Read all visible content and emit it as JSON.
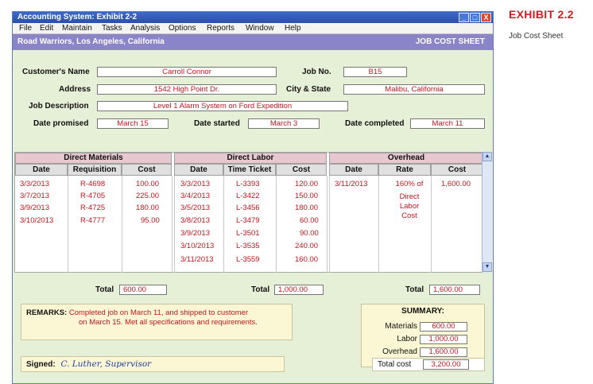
{
  "exhibit": {
    "label": "EXHIBIT 2.2",
    "subtitle": "Job Cost Sheet"
  },
  "window": {
    "title": "Accounting System: Exhibit 2-2",
    "buttons": [
      "_",
      "□",
      "X"
    ]
  },
  "menu": [
    "File",
    "Edit",
    "Maintain",
    "Tasks",
    "Analysis",
    "Options",
    "Reports",
    "Window",
    "Help"
  ],
  "banner": {
    "company": "Road Warriors, Los Angeles, California",
    "sheet_title": "JOB COST SHEET"
  },
  "header": {
    "customer_label": "Customer's Name",
    "customer": "Carroll Connor",
    "job_no_label": "Job No.",
    "job_no": "B15",
    "address_label": "Address",
    "address": "1542 High Point Dr.",
    "city_label": "City & State",
    "city": "Malibu, California",
    "description_label": "Job Description",
    "description": "Level 1 Alarm System on Ford Expedition",
    "date_promised_label": "Date promised",
    "date_promised": "March 15",
    "date_started_label": "Date started",
    "date_started": "March 3",
    "date_completed_label": "Date completed",
    "date_completed": "March 11"
  },
  "table": {
    "groups": [
      "Direct Materials",
      "Direct Labor",
      "Overhead"
    ],
    "columns": [
      "Date",
      "Requisition",
      "Cost",
      "Date",
      "Time Ticket",
      "Cost",
      "Date",
      "Rate",
      "Cost"
    ],
    "materials": [
      {
        "date": "3/3/2013",
        "req": "R-4698",
        "cost": "100.00"
      },
      {
        "date": "3/7/2013",
        "req": "R-4705",
        "cost": "225.00"
      },
      {
        "date": "3/9/2013",
        "req": "R-4725",
        "cost": "180.00"
      },
      {
        "date": "3/10/2013",
        "req": "R-4777",
        "cost": "95.00"
      }
    ],
    "labor": [
      {
        "date": "3/3/2013",
        "ticket": "L-3393",
        "cost": "120.00"
      },
      {
        "date": "3/4/2013",
        "ticket": "L-3422",
        "cost": "150.00"
      },
      {
        "date": "3/5/2013",
        "ticket": "L-3456",
        "cost": "180.00"
      },
      {
        "date": "3/8/2013",
        "ticket": "L-3479",
        "cost": "60.00"
      },
      {
        "date": "3/9/2013",
        "ticket": "L-3501",
        "cost": "90.00"
      },
      {
        "date": "3/10/2013",
        "ticket": "L-3535",
        "cost": "240.00"
      },
      {
        "date": "3/11/2013",
        "ticket": "L-3559",
        "cost": "160.00"
      }
    ],
    "overhead": {
      "date": "3/11/2013",
      "rate_line1": "160% of",
      "rate_rest": [
        "Direct",
        "Labor",
        "Cost"
      ],
      "cost": "1,600.00"
    }
  },
  "totals": {
    "label": "Total",
    "materials": "600.00",
    "labor": "1,000.00",
    "overhead": "1,600.00"
  },
  "remarks": {
    "label": "REMARKS:",
    "line1": "Completed job on March 11, and shipped to customer",
    "line2": "on March 15. Met all specifications and requirements."
  },
  "summary": {
    "title": "SUMMARY:",
    "materials_label": "Materials",
    "materials": "600.00",
    "labor_label": "Labor",
    "labor": "1,000.00",
    "overhead_label": "Overhead",
    "overhead": "1,600.00",
    "total_label": "Total cost",
    "total": "3,200.00"
  },
  "signed": {
    "label": "Signed:",
    "signature": "C. Luther, Supervisor"
  },
  "colors": {
    "entry_red": "#c4161c",
    "banner": "#8a84c8",
    "group_header": "#e7c8cf",
    "panel": "#e6f0d6",
    "note_bg": "#fbf7d4"
  }
}
